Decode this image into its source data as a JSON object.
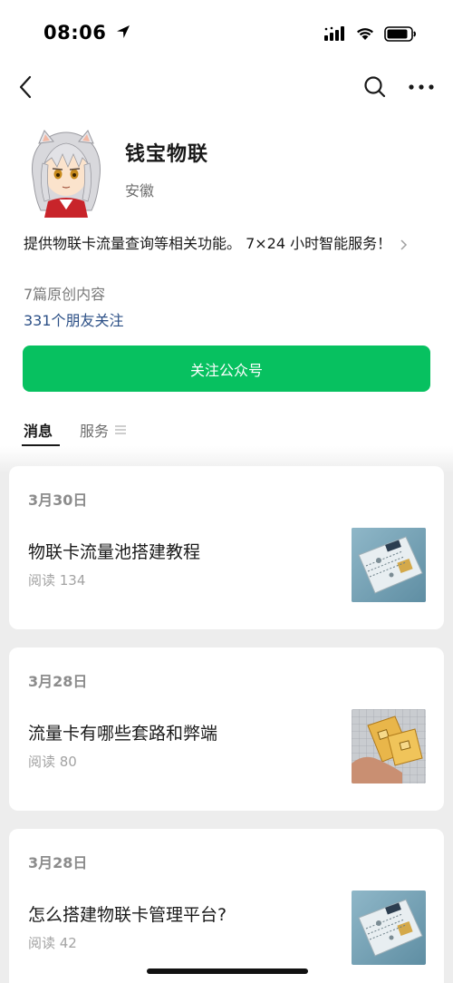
{
  "status_bar": {
    "time": "08:06"
  },
  "profile": {
    "name": "钱宝物联",
    "region": "安徽",
    "description": "提供物联卡流量查询等相关功能。 7×24 小时智能服务！",
    "original_count": "7篇原创内容",
    "friends_following": "331个朋友关注",
    "follow_button": "关注公众号"
  },
  "tabs": [
    {
      "label": "消息",
      "active": true
    },
    {
      "label": "服务",
      "active": false
    }
  ],
  "articles": [
    {
      "date": "3月30日",
      "title": "物联卡流量池搭建教程",
      "reads": "阅读 134",
      "thumb": "iot-sim-card-image"
    },
    {
      "date": "3月28日",
      "title": "流量卡有哪些套路和弊端",
      "reads": "阅读 80",
      "thumb": "hand-holding-sim-cards-image"
    },
    {
      "date": "3月28日",
      "title": "怎么搭建物联卡管理平台?",
      "reads": "阅读 42",
      "thumb": "iot-sim-card-image"
    }
  ],
  "colors": {
    "accent_green": "#07c160",
    "link_blue": "#2b4f86",
    "feed_background": "#ededed"
  }
}
